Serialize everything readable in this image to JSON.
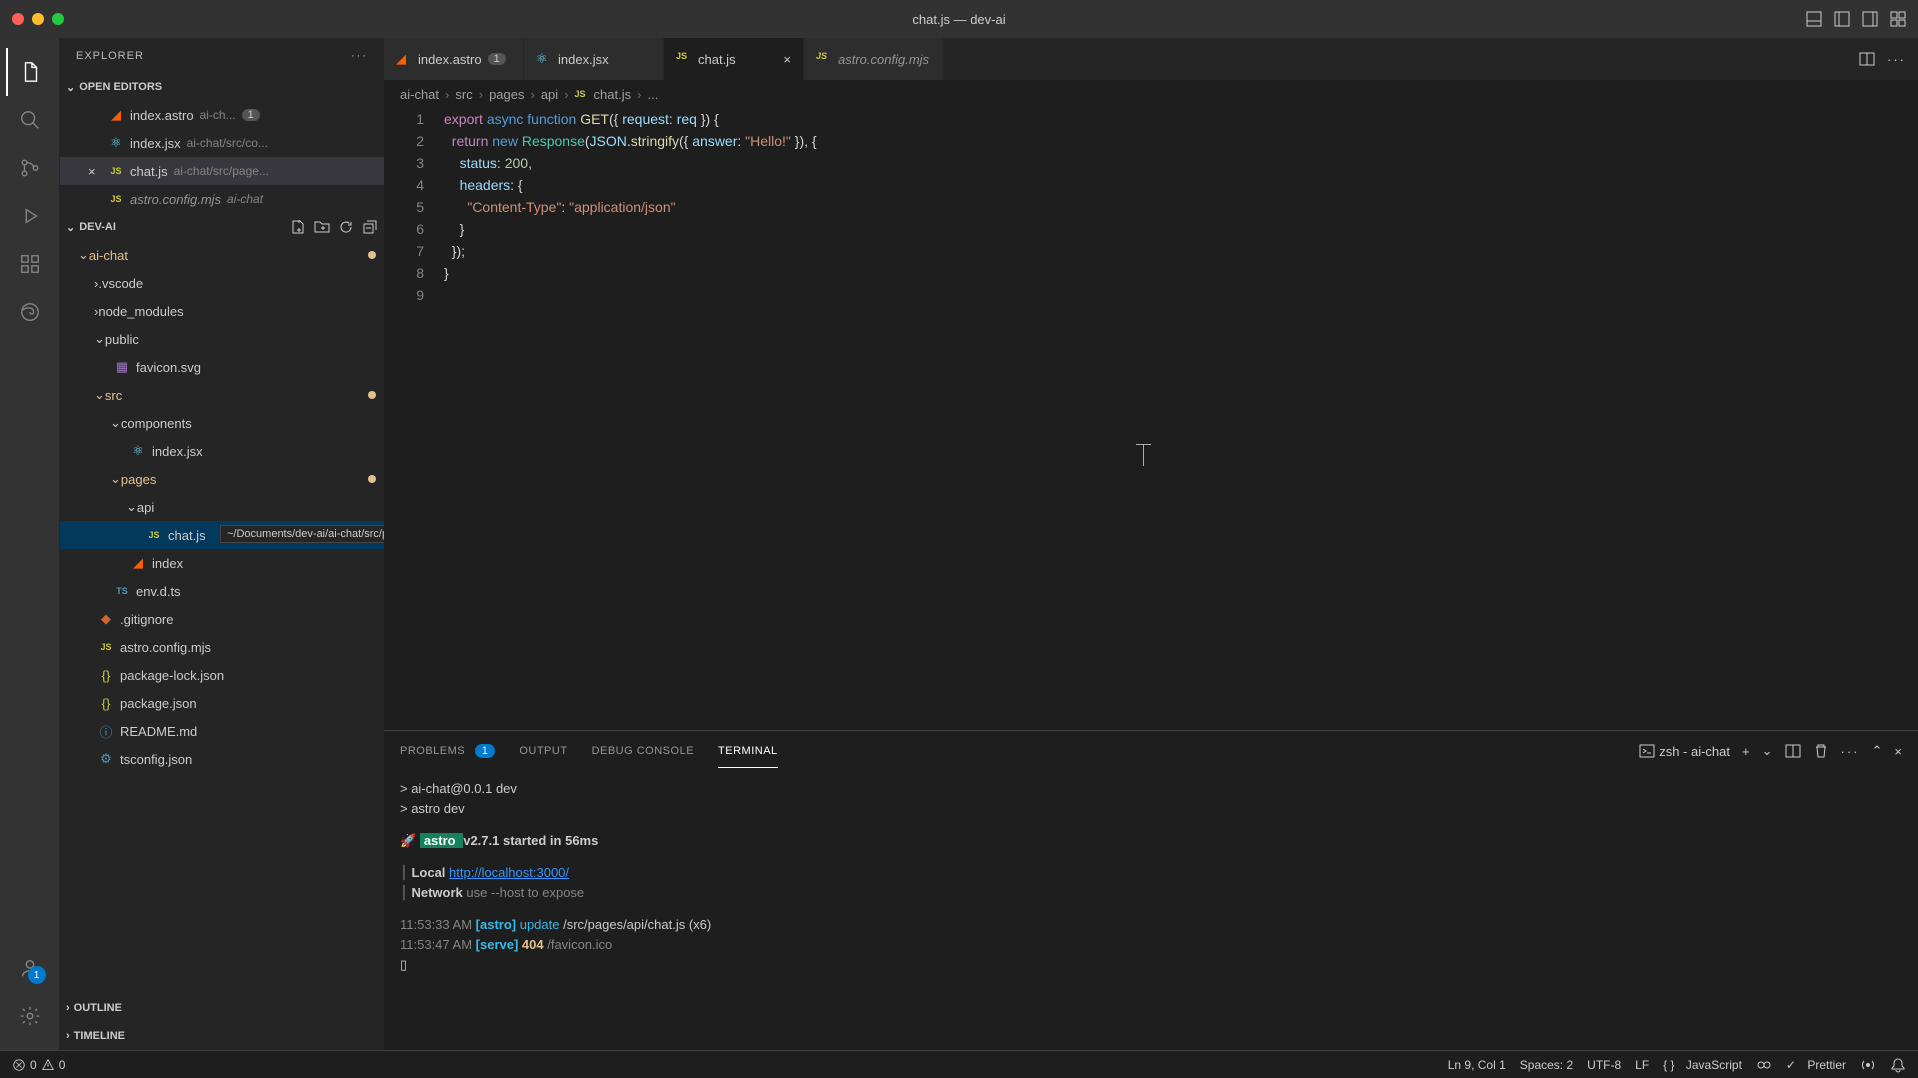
{
  "titlebar": {
    "title": "chat.js — dev-ai"
  },
  "sidebar": {
    "title": "EXPLORER",
    "sections": {
      "open_editors": {
        "label": "OPEN EDITORS",
        "items": [
          {
            "name": "index.astro",
            "detail": "ai-ch...",
            "icon": "astro",
            "problems": "1"
          },
          {
            "name": "index.jsx",
            "detail": "ai-chat/src/co...",
            "icon": "react"
          },
          {
            "name": "chat.js",
            "detail": "ai-chat/src/page...",
            "icon": "js",
            "active": true
          },
          {
            "name": "astro.config.mjs",
            "detail": "ai-chat",
            "icon": "js",
            "italic": true
          }
        ]
      },
      "workspace": {
        "label": "DEV-AI"
      },
      "outline": {
        "label": "OUTLINE"
      },
      "timeline": {
        "label": "TIMELINE"
      }
    },
    "tree": {
      "ai_chat": "ai-chat",
      "vscode": ".vscode",
      "node_modules": "node_modules",
      "public": "public",
      "favicon": "favicon.svg",
      "src": "src",
      "components": "components",
      "index_jsx": "index.jsx",
      "pages": "pages",
      "api": "api",
      "chat_js": "chat.js",
      "index_astro": "index",
      "env": "env.d.ts",
      "gitignore": ".gitignore",
      "astro_config": "astro.config.mjs",
      "pkg_lock": "package-lock.json",
      "pkg": "package.json",
      "readme": "README.md",
      "tsconfig": "tsconfig.json"
    },
    "tooltip": "~/Documents/dev-ai/ai-chat/src/pages/api/chat.js"
  },
  "tabs": [
    {
      "name": "index.astro",
      "icon": "astro",
      "problems": "1"
    },
    {
      "name": "index.jsx",
      "icon": "react"
    },
    {
      "name": "chat.js",
      "icon": "js",
      "active": true
    },
    {
      "name": "astro.config.mjs",
      "icon": "js",
      "italic": true
    }
  ],
  "breadcrumb": {
    "p1": "ai-chat",
    "p2": "src",
    "p3": "pages",
    "p4": "api",
    "p5": "chat.js",
    "p6": "..."
  },
  "code": {
    "lines": [
      "1",
      "2",
      "3",
      "4",
      "5",
      "6",
      "7",
      "8",
      "9"
    ]
  },
  "panel": {
    "tabs": {
      "problems": "PROBLEMS",
      "problems_badge": "1",
      "output": "OUTPUT",
      "debug": "DEBUG CONSOLE",
      "terminal": "TERMINAL"
    },
    "terminal_label": "zsh - ai-chat",
    "terminal": {
      "l1": "> ai-chat@0.0.1 dev",
      "l2": "> astro dev",
      "rocket": "🚀",
      "astro_badge": " astro ",
      "l3_rest": "  v2.7.1 started in 56ms",
      "local_label": "Local",
      "local_url": "http://localhost:3000/",
      "network_label": "Network",
      "network_hint": "use --host to expose",
      "ts1": "11:53:33 AM ",
      "tag1": "[astro]",
      "upd": " update",
      "path1": " /src/pages/api/chat.js (x6)",
      "ts2": "11:53:47 AM ",
      "tag2": "[serve]",
      "code404": "   404",
      "path2": "                             /favicon.ico",
      "cursor": "▯"
    }
  },
  "status": {
    "errors": "0",
    "warnings": "0",
    "ln_col": "Ln 9, Col 1",
    "spaces": "Spaces: 2",
    "encoding": "UTF-8",
    "eol": "LF",
    "lang": "JavaScript",
    "prettier": "Prettier"
  }
}
